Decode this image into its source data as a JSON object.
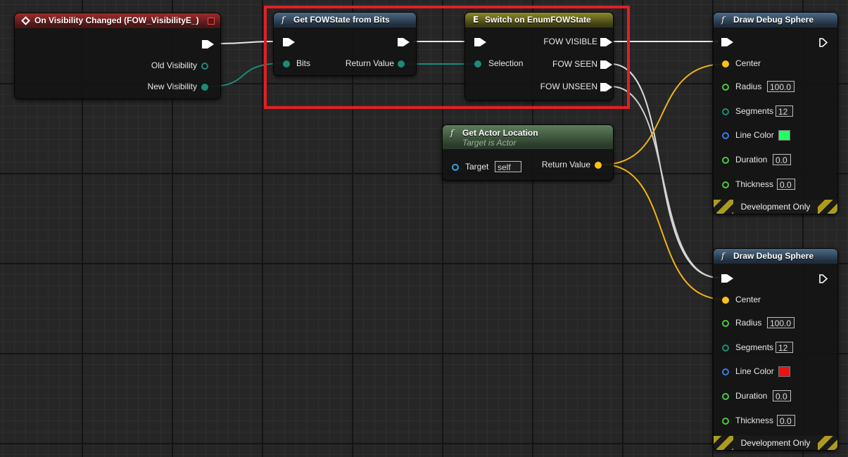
{
  "colors": {
    "selection_highlight": "#e02025",
    "line_color_1": "#22ff66",
    "line_color_2": "#ee1111"
  },
  "event_node": {
    "title": "On Visibility Changed (FOW_VisibilityE_)",
    "icon": "event-diamond-icon",
    "pins": [
      "Old Visibility",
      "New Visibility"
    ]
  },
  "get_fow_state": {
    "title": "Get FOWState from Bits",
    "icon": "function-icon",
    "input_label": "Bits",
    "output_label": "Return Value"
  },
  "switch_node": {
    "title": "Switch on EnumFOWState",
    "icon": "switch-icon",
    "input_label": "Selection",
    "outputs": [
      "FOW VISIBLE",
      "FOW SEEN",
      "FOW UNSEEN"
    ]
  },
  "get_actor_location": {
    "title": "Get Actor Location",
    "subtitle": "Target is Actor",
    "icon": "function-icon",
    "target_label": "Target",
    "target_value": "self",
    "output_label": "Return Value"
  },
  "draw_debug_sphere_1": {
    "title": "Draw Debug Sphere",
    "center_label": "Center",
    "radius_label": "Radius",
    "radius_value": "100.0",
    "segments_label": "Segments",
    "segments_value": "12",
    "line_color_label": "Line Color",
    "duration_label": "Duration",
    "duration_value": "0.0",
    "thickness_label": "Thickness",
    "thickness_value": "0.0",
    "footer": "Development Only"
  },
  "draw_debug_sphere_2": {
    "title": "Draw Debug Sphere",
    "center_label": "Center",
    "radius_label": "Radius",
    "radius_value": "100.0",
    "segments_label": "Segments",
    "segments_value": "12",
    "line_color_label": "Line Color",
    "duration_label": "Duration",
    "duration_value": "0.0",
    "thickness_label": "Thickness",
    "thickness_value": "0.0",
    "footer": "Development Only"
  }
}
